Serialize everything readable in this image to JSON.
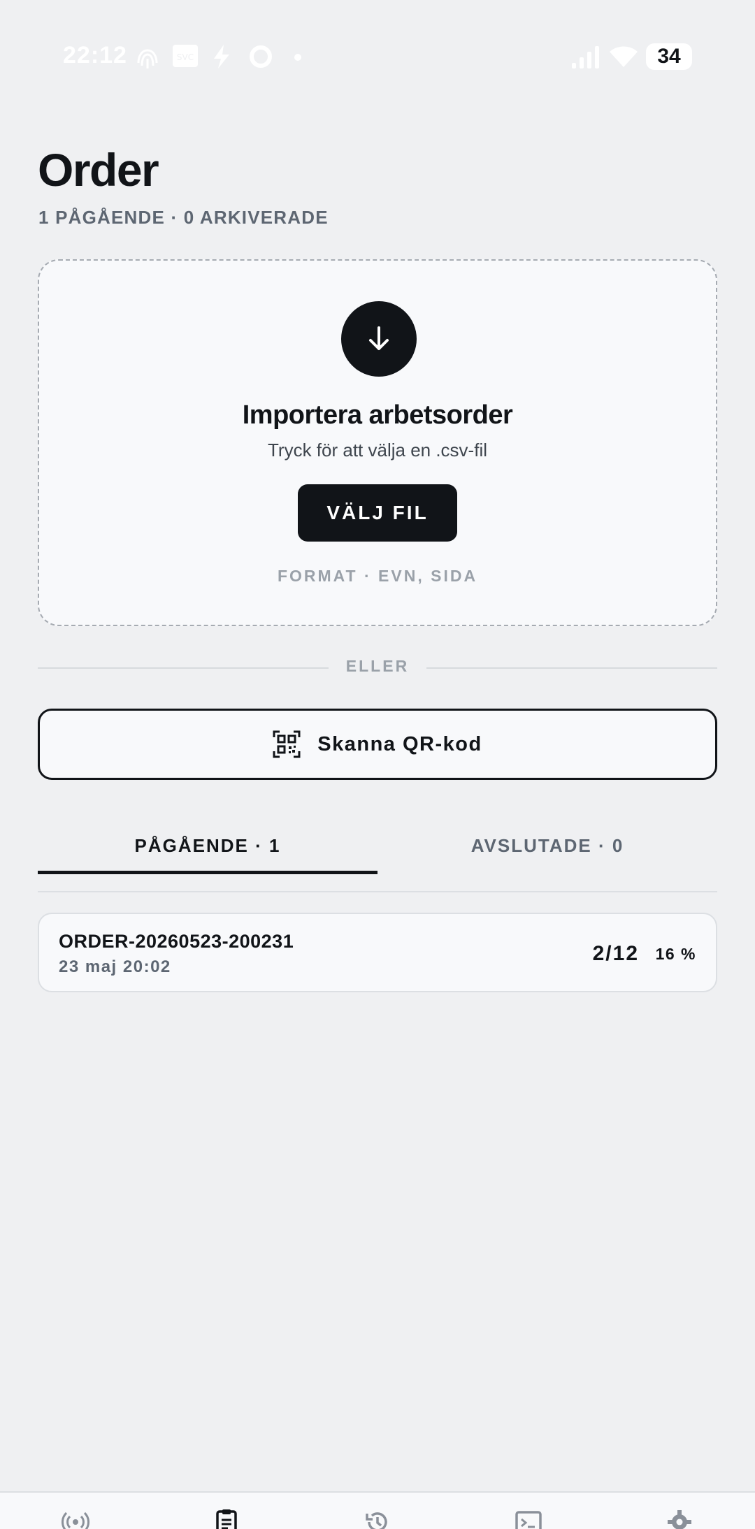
{
  "status_bar": {
    "time": "22:12",
    "battery": "34",
    "icons": [
      "fingerprint-icon",
      "svc-icon",
      "bolt-icon",
      "ring-icon",
      "dot-icon",
      "signal-icon",
      "wifi-icon",
      "battery-icon"
    ]
  },
  "header": {
    "title": "Order",
    "subtitle": "1 PÅGÅENDE · 0 ARKIVERADE"
  },
  "import_card": {
    "icon": "arrow-down-icon",
    "title": "Importera arbetsorder",
    "hint": "Tryck för att välja en .csv-fil",
    "button_label": "VÄLJ FIL",
    "format": "FORMAT · EVN, SIDA"
  },
  "divider": {
    "label": "ELLER"
  },
  "qr_button": {
    "icon": "qr-code-icon",
    "label": "Skanna QR-kod"
  },
  "tabs": [
    {
      "label": "PÅGÅENDE · 1",
      "active": true
    },
    {
      "label": "AVSLUTADE · 0",
      "active": false
    }
  ],
  "orders": [
    {
      "id": "ORDER-20260523-200231",
      "date": "23 maj 20:02",
      "count": "2/12",
      "percent": "16 %"
    }
  ],
  "bottom_nav": [
    "broadcast-icon",
    "clipboard-icon",
    "history-icon",
    "terminal-icon",
    "gear-icon"
  ],
  "colors": {
    "accent": "#111418",
    "background": "#eff0f2",
    "card": "#f8f9fb",
    "muted": "#5d6672"
  }
}
